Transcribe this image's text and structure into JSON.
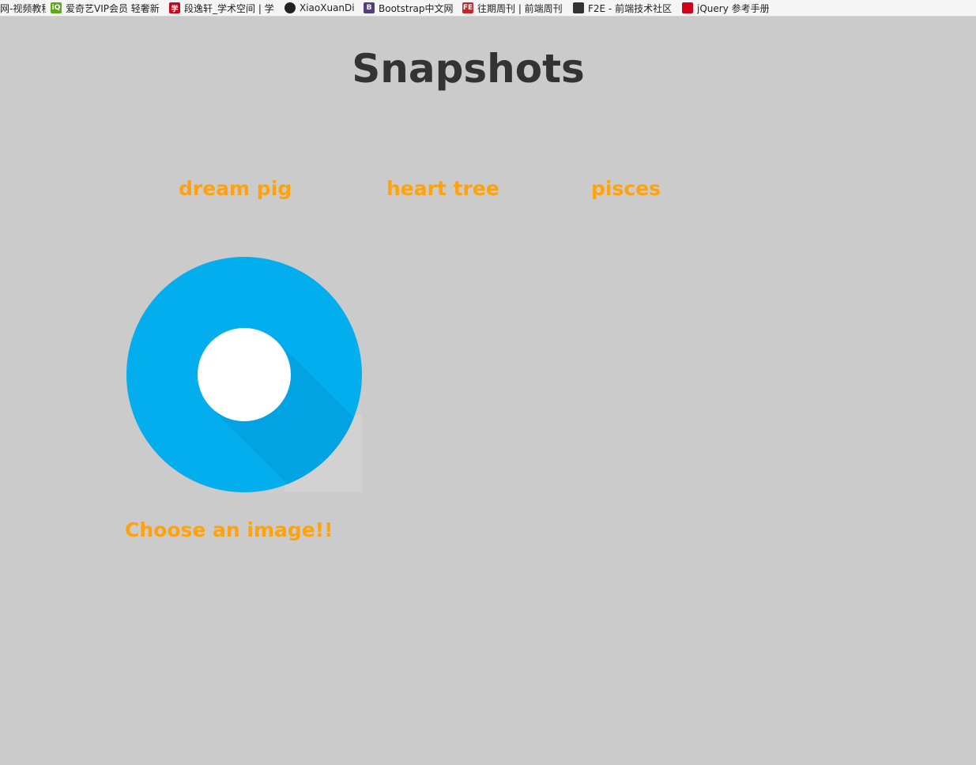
{
  "bookmarks": [
    {
      "label": "网-视频教程",
      "icon": "",
      "icon_name": "none",
      "color": "#f5f5f5",
      "width": 64
    },
    {
      "label": "爱奇艺VIP会员 轻奢新",
      "icon": "iQ",
      "icon_name": "iqiyi-icon",
      "color": "#5fa716",
      "width": 150
    },
    {
      "label": "段逸轩_学术空间 | 学",
      "icon": "学",
      "icon_name": "scholar-icon",
      "color": "#d0021b",
      "width": 146
    },
    {
      "label": "XiaoXuanDi",
      "icon": "",
      "icon_name": "github-icon",
      "color": "#222222",
      "width": 100
    },
    {
      "label": "Bootstrap中文网",
      "icon": "B",
      "icon_name": "bootstrap-icon",
      "color": "#563d7c",
      "width": 125
    },
    {
      "label": "往期周刊 | 前端周刊",
      "icon": "FE",
      "icon_name": "fe-weekly-icon",
      "color": "#c0282e",
      "width": 140
    },
    {
      "label": "F2E - 前端技术社区",
      "icon": "",
      "icon_name": "f2e-icon",
      "color": "#333333",
      "width": 138
    },
    {
      "label": "jQuery 参考手册",
      "icon": "",
      "icon_name": "jquery-manual-icon",
      "color": "#d0021b",
      "width": 120
    }
  ],
  "title": "Snapshots",
  "nav": [
    {
      "label": "dream pig"
    },
    {
      "label": "heart tree"
    },
    {
      "label": "pisces"
    }
  ],
  "caption": "Choose an image!!",
  "colors": {
    "background": "#cbcbcb",
    "accent": "#fea20d",
    "title": "#333333",
    "logo_ring": "#03aeef",
    "logo_center": "#ffffff"
  }
}
